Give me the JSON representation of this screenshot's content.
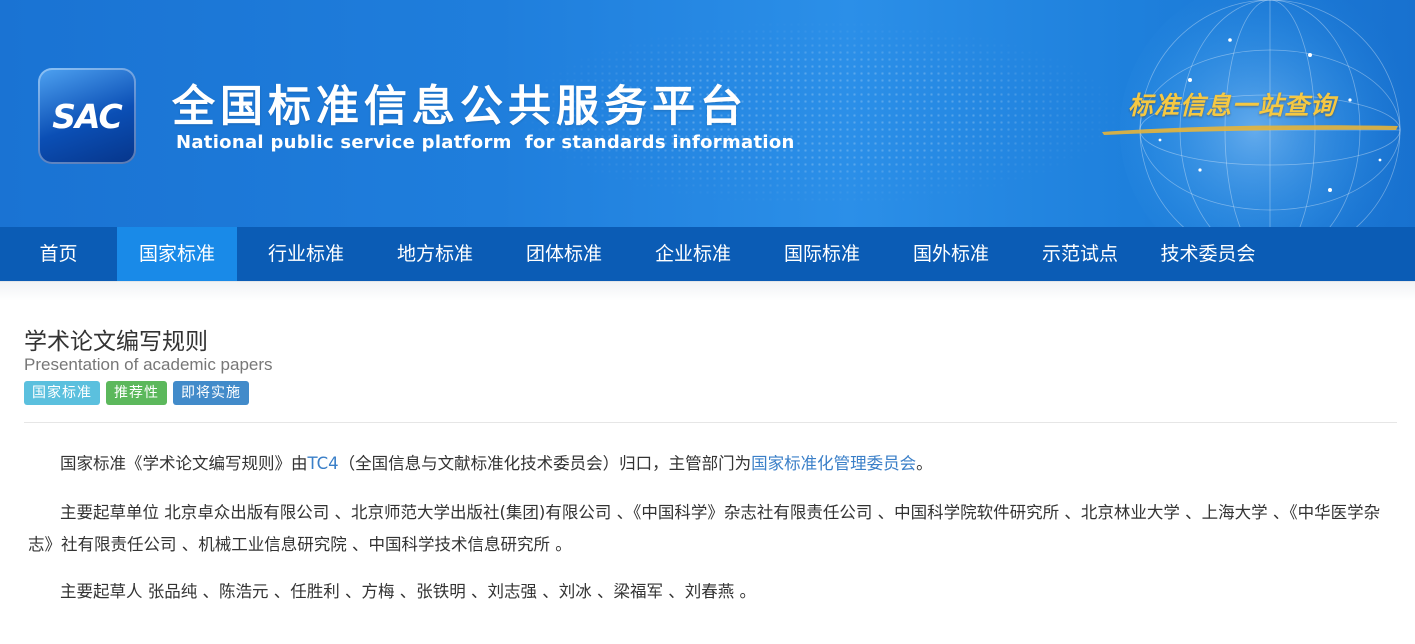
{
  "header": {
    "logo_text": "SAC",
    "title": "全国标准信息公共服务平台",
    "subtitle": "National public service platform  for standards information",
    "slogan": "标准信息一站查询",
    "colors": {
      "banner": "#1f7edc",
      "slogan": "#f5c842"
    }
  },
  "nav": {
    "items": [
      {
        "label": "首页"
      },
      {
        "label": "国家标准",
        "active": true
      },
      {
        "label": "行业标准"
      },
      {
        "label": "地方标准"
      },
      {
        "label": "团体标准"
      },
      {
        "label": "企业标准"
      },
      {
        "label": "国际标准"
      },
      {
        "label": "国外标准"
      },
      {
        "label": "示范试点"
      },
      {
        "label": "技术委员会"
      }
    ],
    "colors": {
      "bar": "#0b5cb5",
      "active": "#198ae8"
    }
  },
  "standard": {
    "title_cn": "学术论文编写规则",
    "title_en": "Presentation of academic papers",
    "badges": [
      {
        "label": "国家标准",
        "color": "#5bc0de"
      },
      {
        "label": "推荐性",
        "color": "#5cb85c"
      },
      {
        "label": "即将实施",
        "color": "#428bca"
      }
    ]
  },
  "description": {
    "p1_before": "国家标准《学术论文编写规则》由",
    "p1_tc_link": "TC4",
    "p1_middle": "（全国信息与文献标准化技术委员会）归口，主管部门为",
    "p1_dept_link": "国家标准化管理委员会",
    "p1_end": "。",
    "p2": "主要起草单位 北京卓众出版有限公司 、北京师范大学出版社(集团)有限公司 、《中国科学》杂志社有限责任公司 、中国科学院软件研究所 、北京林业大学 、上海大学 、《中华医学杂志》社有限责任公司 、机械工业信息研究院 、中国科学技术信息研究所 。",
    "p3": "主要起草人 张品纯 、陈浩元 、任胜利 、方梅 、张铁明 、刘志强 、刘冰 、梁福军 、刘春燕 。",
    "link_color": "#3a7fc8"
  }
}
